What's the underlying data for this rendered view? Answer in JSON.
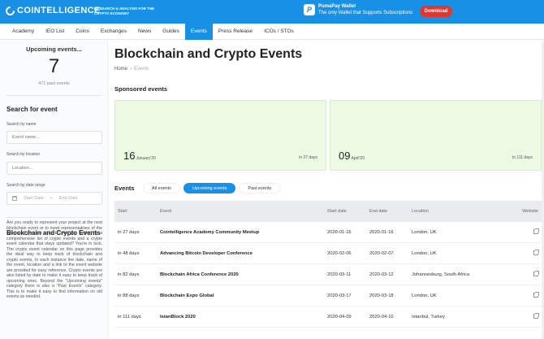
{
  "header": {
    "logo": "COINTELLIGENCE",
    "tagline": "RESEARCH & ANALYSIS FOR THE CRYPTO ECONOMY",
    "promo_title": "PumaPay Wallet",
    "promo_sub": "The only Wallet that Supports Subscriptions",
    "download_label": "Download",
    "brand_color": "#1790e6"
  },
  "nav": [
    {
      "label": "Academy"
    },
    {
      "label": "IEO List"
    },
    {
      "label": "Coins"
    },
    {
      "label": "Exchanges"
    },
    {
      "label": "News"
    },
    {
      "label": "Guides"
    },
    {
      "label": "Events",
      "active": true
    },
    {
      "label": "Press Release"
    },
    {
      "label": "ICOs / STOs"
    }
  ],
  "sidebar": {
    "upcoming_title": "Upcoming events...",
    "upcoming_count": "7",
    "past_events": "471 past events",
    "search_heading": "Search for event",
    "by_name_label": "Search by name",
    "name_placeholder": "Event name...",
    "by_location_label": "Search by location",
    "location_placeholder": "Location...",
    "by_date_label": "Search by date range",
    "start_date_placeholder": "Start Date",
    "date_separator": "–",
    "end_date_placeholder": "End Date",
    "about_heading": "Blockchain and Crypto Events",
    "about_text": "Are you ready to represent your project at the next blockchain event or to meet representatives of the latest and greatest projects? Are you looking for a comprehensive list of crypto events and a crypto event calendar that stays updated? You're in luck. The crypto event calendar on this page provides the ideal way to keep track of blockchain and crypto events. In each instance the date, name of the event, location and a link to the event website are provided for easy reference. Crypto events are also listed by date to make it easy to keep track of upcoming ones. Beyond the \"Upcoming events\" category there is also a \"Past Events\" category. This is to make it easy to find information on old events as needed."
  },
  "main": {
    "title": "Blockchain and Crypto Events",
    "breadcrumb": {
      "home": "Home",
      "sep": "›",
      "current": "Events"
    },
    "sponsored_heading": "Sponsored events",
    "sponsored": [
      {
        "day": "16",
        "month": "January'20",
        "in": "in 27 days"
      },
      {
        "day": "09",
        "month": "April'20",
        "in": "in 111 days"
      }
    ],
    "events_heading": "Events",
    "tabs": [
      {
        "label": "All events"
      },
      {
        "label": "Upcoming events",
        "active": true
      },
      {
        "label": "Past events"
      }
    ],
    "table": {
      "headers": {
        "start": "Start",
        "event": "Event",
        "start_date": "Start date",
        "end_date": "End date",
        "location": "Location",
        "website": "Website"
      },
      "rows": [
        {
          "start": "in 27 days",
          "event": "Cointelligence Academy Community Meetup",
          "start_date": "2020-01-16",
          "end_date": "2020-01-16",
          "location": "London, UK"
        },
        {
          "start": "in 48 days",
          "event": "Advancing Bitcoin Developer Conference",
          "start_date": "2020-02-06",
          "end_date": "2020-02-07",
          "location": "London, UK"
        },
        {
          "start": "in 82 days",
          "event": "Blockchain Africa Conference 2020",
          "start_date": "2020-03-11",
          "end_date": "2020-03-12",
          "location": "Johannesburg, South Africa"
        },
        {
          "start": "in 88 days",
          "event": "Blockchain Expo Global",
          "start_date": "2020-03-17",
          "end_date": "2020-03-18",
          "location": "London, UK"
        },
        {
          "start": "in 111 days",
          "event": "IstanBlock 2020",
          "start_date": "2020-04-09",
          "end_date": "2020-04-10",
          "location": "Istanbul, Turkey"
        }
      ]
    }
  }
}
